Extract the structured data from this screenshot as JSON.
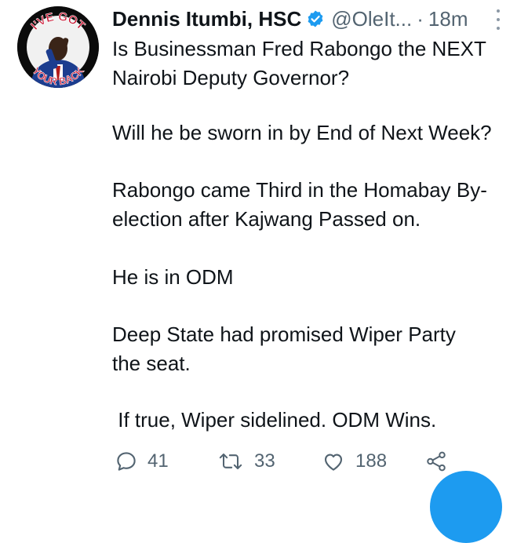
{
  "tweet": {
    "author_name": "Dennis Itumbi, HSC",
    "handle": "@OleIt...",
    "separator": "·",
    "time": "18m",
    "avatar": {
      "top_text": "I'VE GOT",
      "bottom_text": "YOUR BACK"
    },
    "lines": [
      "Is Businessman Fred Rabongo  the NEXT",
      "Nairobi Deputy Governor?",
      "Will he be sworn in by End of Next Week?",
      "Rabongo came Third in the Homabay By-",
      "election after Kajwang Passed on.",
      "He is in ODM",
      "Deep State had promised Wiper Party",
      "the seat.",
      " If true, Wiper sidelined. ODM Wins."
    ],
    "counts": {
      "replies": "41",
      "retweets": "33",
      "likes": "188"
    }
  },
  "icons": {
    "verified": "verified-badge-icon",
    "more": "more-vertical-icon",
    "reply": "comment-icon",
    "retweet": "retweet-icon",
    "like": "heart-icon",
    "share": "share-icon"
  },
  "colors": {
    "accent": "#1d9bf0",
    "text": "#0f1419",
    "muted": "#536471"
  }
}
